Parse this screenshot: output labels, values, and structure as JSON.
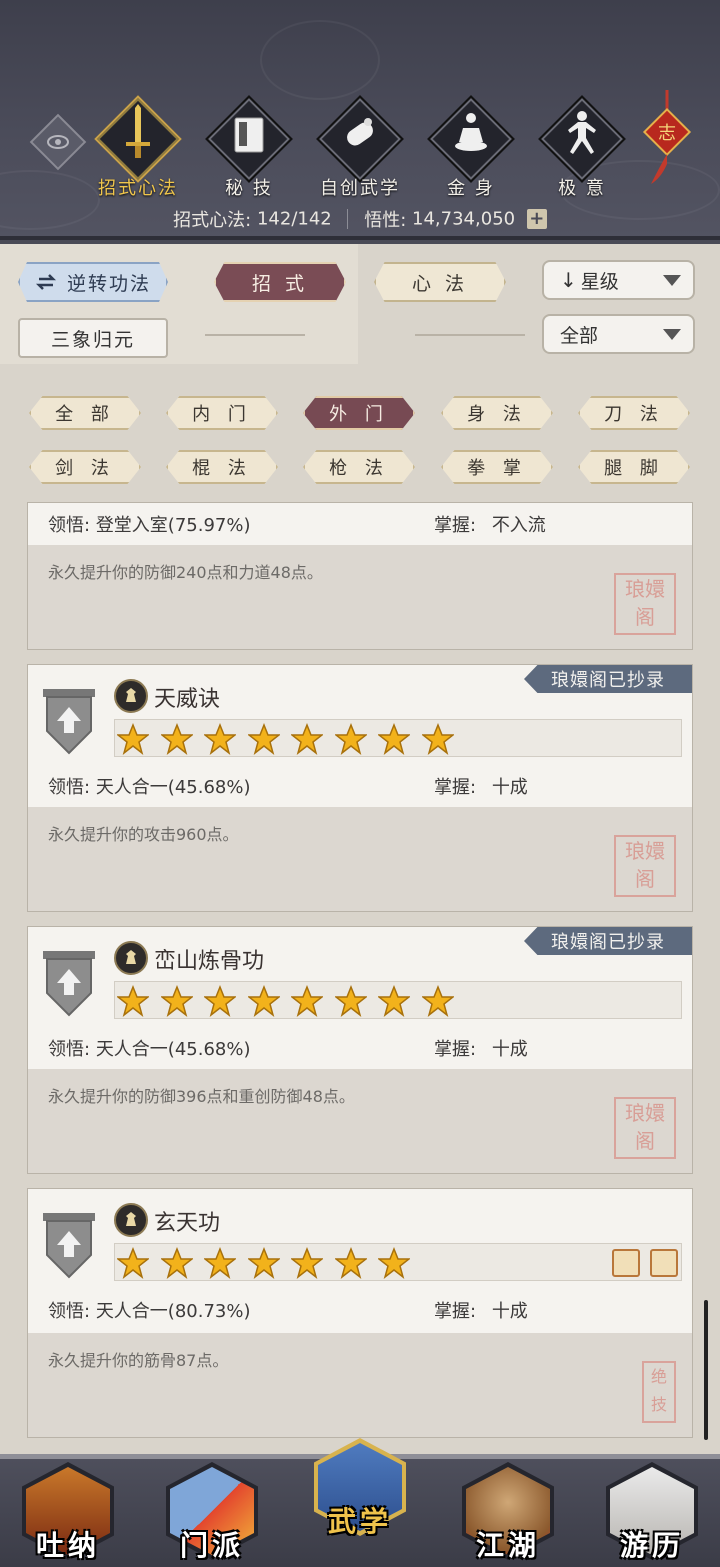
{
  "header": {
    "categories": [
      {
        "label": "招式心法",
        "icon": "sword-icon",
        "active": true
      },
      {
        "label": "秘 技",
        "icon": "book-icon",
        "active": false
      },
      {
        "label": "自创武学",
        "icon": "scroll-icon",
        "active": false
      },
      {
        "label": "金 身",
        "icon": "meditation-icon",
        "active": false
      },
      {
        "label": "极 意",
        "icon": "martial-pose-icon",
        "active": false
      }
    ],
    "knot_char": "志",
    "stats": {
      "skills_label": "招式心法:",
      "skills_value": "142/142",
      "insight_label": "悟性:",
      "insight_value": "14,734,050",
      "plus": "+"
    }
  },
  "filters": {
    "reverse_button": "逆转功法",
    "tab_moves": "招 式",
    "tab_mental": "心 法",
    "sort_select": "星级",
    "sanxiang_button": "三象归元",
    "scope_select": "全部",
    "tags": [
      "全 部",
      "内 门",
      "外 门",
      "身 法",
      "刀 法",
      "剑 法",
      "棍 法",
      "枪 法",
      "拳 掌",
      "腿 脚"
    ],
    "active_tag": 2
  },
  "skills": [
    {
      "name": "",
      "comprehension_label": "领悟:",
      "comprehension": "登堂入室(75.97%)",
      "mastery_label": "掌握:",
      "mastery": "不入流",
      "description": "永久提升你的防御240点和力道48点。",
      "copied": false,
      "stars": 0,
      "seal": "琅嬛阁"
    },
    {
      "name": "天威诀",
      "comprehension_label": "领悟:",
      "comprehension": "天人合一(45.68%)",
      "mastery_label": "掌握:",
      "mastery": "十成",
      "description": "永久提升你的攻击960点。",
      "copied": true,
      "copied_label": "琅嬛阁已抄录",
      "stars": 8,
      "seal": "琅嬛阁"
    },
    {
      "name": "峦山炼骨功",
      "comprehension_label": "领悟:",
      "comprehension": "天人合一(45.68%)",
      "mastery_label": "掌握:",
      "mastery": "十成",
      "description": "永久提升你的防御396点和重创防御48点。",
      "copied": true,
      "copied_label": "琅嬛阁已抄录",
      "stars": 8,
      "seal": "琅嬛阁"
    },
    {
      "name": "玄天功",
      "comprehension_label": "领悟:",
      "comprehension": "天人合一(80.73%)",
      "mastery_label": "掌握:",
      "mastery": "十成",
      "description": "永久提升你的筋骨87点。",
      "copied": false,
      "stars": 7,
      "seal": "绝技"
    }
  ],
  "nav": [
    {
      "label": "吐纳",
      "icon": "monk-icon",
      "active": false
    },
    {
      "label": "门派",
      "icon": "sect-flag-icon",
      "active": false
    },
    {
      "label": "武学",
      "icon": "martial-book-icon",
      "active": true
    },
    {
      "label": "江湖",
      "icon": "straw-hat-icon",
      "active": false
    },
    {
      "label": "游历",
      "icon": "horse-icon",
      "active": false
    }
  ],
  "colors": {
    "header_bg": "#4a4b57",
    "active_gold": "#f0c64c",
    "active_tab": "#7a4c55",
    "ribbon": "#5d6a7e",
    "star": "#f2b21b"
  }
}
